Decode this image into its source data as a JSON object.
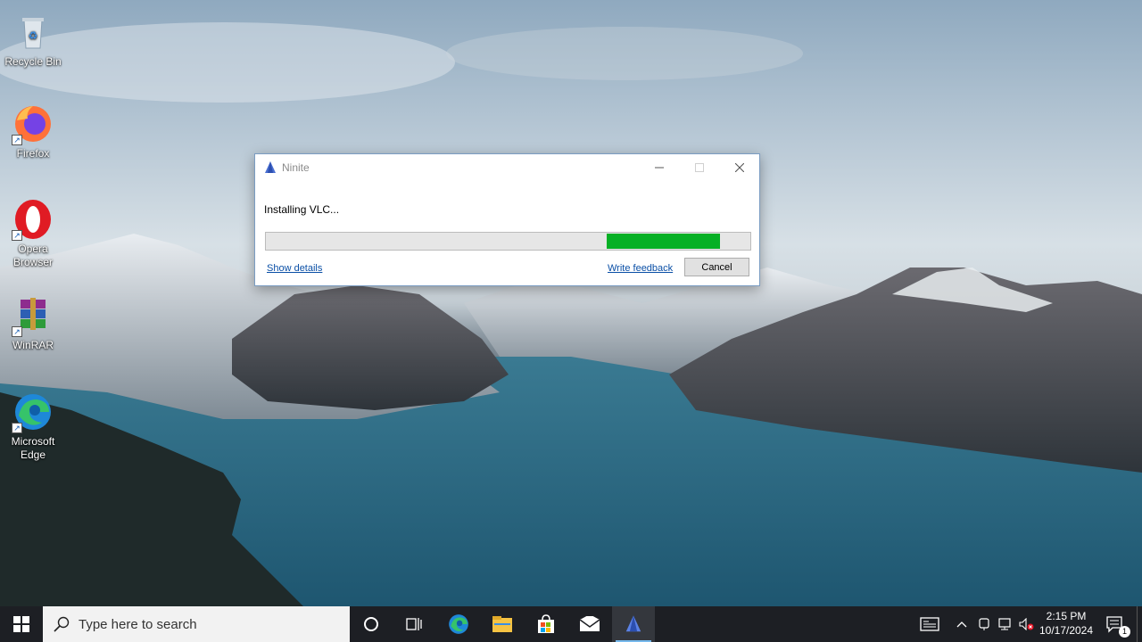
{
  "desktop": {
    "icons": [
      {
        "label": "Recycle Bin",
        "icon": "recycle-bin-icon"
      },
      {
        "label": "Firefox",
        "icon": "firefox-icon"
      },
      {
        "label": "Opera Browser",
        "icon": "opera-icon"
      },
      {
        "label": "WinRAR",
        "icon": "winrar-icon"
      },
      {
        "label": "Microsoft Edge",
        "icon": "edge-icon"
      }
    ]
  },
  "window": {
    "title": "Ninite",
    "status_text": "Installing VLC...",
    "progress": {
      "segment_start": 0.703,
      "segment_end": 0.937,
      "color": "#06b025",
      "indeterminate": true
    },
    "show_details_label": "Show details",
    "write_feedback_label": "Write feedback",
    "cancel_label": "Cancel"
  },
  "taskbar": {
    "search_placeholder": "Type here to search",
    "pinned": [
      "cortana-icon",
      "task-view-icon",
      "edge-icon",
      "file-explorer-icon",
      "store-icon",
      "mail-icon",
      "ninite-icon"
    ],
    "active_app": "ninite-icon",
    "clock": {
      "time": "2:15 PM",
      "date": "10/17/2024"
    },
    "notifications_count": "1"
  },
  "colors": {
    "accent": "#76b9ed",
    "taskbar": "#1d1f24",
    "progress": "#06b025",
    "link": "#0a4fa6"
  }
}
